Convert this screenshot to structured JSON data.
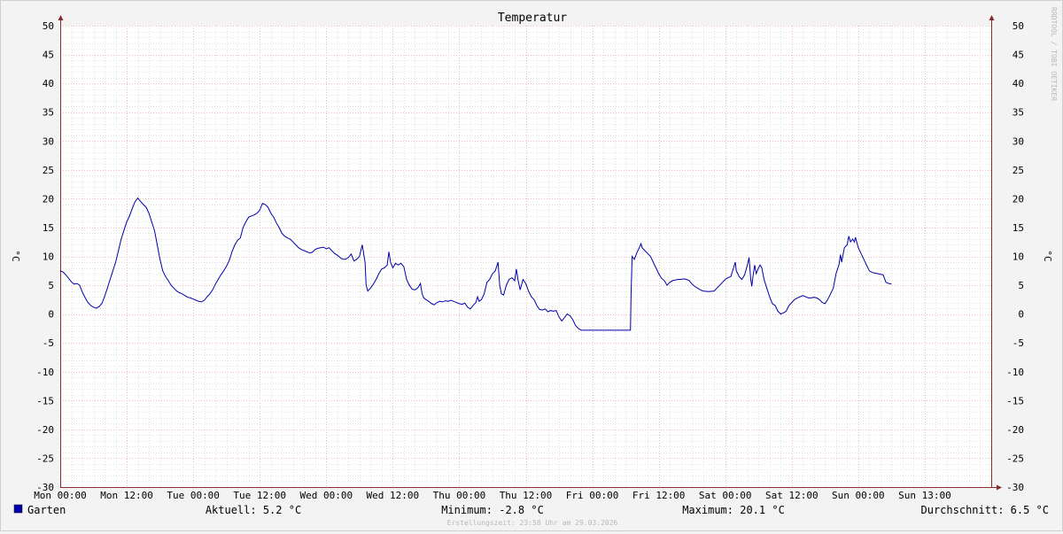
{
  "chart_data": {
    "type": "line",
    "title": "Temperatur",
    "ylabel": "°C",
    "ylabel_right": "°C",
    "ylim": [
      -30,
      50
    ],
    "ytick_step": 5,
    "xlim_hours": [
      0,
      168
    ],
    "x_ticks": [
      {
        "hour": 0,
        "label": "Mon 00:00"
      },
      {
        "hour": 12,
        "label": "Mon 12:00"
      },
      {
        "hour": 24,
        "label": "Tue 00:00"
      },
      {
        "hour": 36,
        "label": "Tue 12:00"
      },
      {
        "hour": 48,
        "label": "Wed 00:00"
      },
      {
        "hour": 60,
        "label": "Wed 12:00"
      },
      {
        "hour": 72,
        "label": "Thu 00:00"
      },
      {
        "hour": 84,
        "label": "Thu 12:00"
      },
      {
        "hour": 96,
        "label": "Fri 00:00"
      },
      {
        "hour": 108,
        "label": "Fri 12:00"
      },
      {
        "hour": 120,
        "label": "Sat 00:00"
      },
      {
        "hour": 132,
        "label": "Sat 12:00"
      },
      {
        "hour": 144,
        "label": "Sun 00:00"
      },
      {
        "hour": 156,
        "label": "Sun 13:00"
      }
    ],
    "grid": true,
    "series": [
      {
        "name": "Garten",
        "color": "#0000aa",
        "points": [
          [
            0,
            7.5
          ],
          [
            0.5,
            7.3
          ],
          [
            1,
            6.8
          ],
          [
            1.5,
            6.2
          ],
          [
            2,
            5.6
          ],
          [
            2.5,
            5.2
          ],
          [
            3,
            5.3
          ],
          [
            3.5,
            5.0
          ],
          [
            4,
            3.8
          ],
          [
            4.5,
            2.8
          ],
          [
            5,
            2.0
          ],
          [
            5.5,
            1.5
          ],
          [
            6,
            1.2
          ],
          [
            6.5,
            1.0
          ],
          [
            7,
            1.3
          ],
          [
            7.5,
            1.8
          ],
          [
            8,
            3.0
          ],
          [
            8.5,
            4.5
          ],
          [
            9,
            6.0
          ],
          [
            9.5,
            7.5
          ],
          [
            10,
            9.0
          ],
          [
            10.5,
            11.0
          ],
          [
            11,
            13.0
          ],
          [
            11.5,
            14.5
          ],
          [
            12,
            16.0
          ],
          [
            12.5,
            17.0
          ],
          [
            13,
            18.3
          ],
          [
            13.5,
            19.5
          ],
          [
            14,
            20.1
          ],
          [
            14.5,
            19.5
          ],
          [
            15,
            19.0
          ],
          [
            15.5,
            18.5
          ],
          [
            16,
            17.5
          ],
          [
            16.5,
            16.0
          ],
          [
            17,
            14.5
          ],
          [
            17.5,
            12.0
          ],
          [
            18,
            9.5
          ],
          [
            18.5,
            7.5
          ],
          [
            19,
            6.5
          ],
          [
            19.5,
            5.8
          ],
          [
            20,
            5.0
          ],
          [
            20.5,
            4.5
          ],
          [
            21,
            4.0
          ],
          [
            21.5,
            3.7
          ],
          [
            22,
            3.5
          ],
          [
            22.5,
            3.2
          ],
          [
            23,
            2.9
          ],
          [
            23.5,
            2.8
          ],
          [
            24,
            2.6
          ],
          [
            24.5,
            2.4
          ],
          [
            25,
            2.2
          ],
          [
            25.5,
            2.1
          ],
          [
            26,
            2.4
          ],
          [
            26.5,
            3.0
          ],
          [
            27,
            3.5
          ],
          [
            27.5,
            4.2
          ],
          [
            28,
            5.2
          ],
          [
            28.5,
            6.0
          ],
          [
            29,
            6.8
          ],
          [
            29.5,
            7.5
          ],
          [
            30,
            8.3
          ],
          [
            30.5,
            9.3
          ],
          [
            31,
            10.8
          ],
          [
            31.5,
            12.0
          ],
          [
            32,
            12.8
          ],
          [
            32.5,
            13.2
          ],
          [
            33,
            15.0
          ],
          [
            33.5,
            16.0
          ],
          [
            34,
            16.8
          ],
          [
            34.5,
            17.0
          ],
          [
            35,
            17.2
          ],
          [
            35.5,
            17.5
          ],
          [
            36,
            18.0
          ],
          [
            36.5,
            19.2
          ],
          [
            37,
            19.0
          ],
          [
            37.5,
            18.5
          ],
          [
            38,
            17.5
          ],
          [
            38.5,
            16.8
          ],
          [
            39,
            15.8
          ],
          [
            39.5,
            15.0
          ],
          [
            40,
            14.0
          ],
          [
            40.5,
            13.5
          ],
          [
            41,
            13.2
          ],
          [
            41.5,
            13.0
          ],
          [
            42,
            12.5
          ],
          [
            42.5,
            12.0
          ],
          [
            43,
            11.5
          ],
          [
            43.5,
            11.2
          ],
          [
            44,
            11.0
          ],
          [
            44.5,
            10.8
          ],
          [
            45,
            10.6
          ],
          [
            45.5,
            10.7
          ],
          [
            46,
            11.2
          ],
          [
            46.5,
            11.4
          ],
          [
            47,
            11.5
          ],
          [
            47.5,
            11.6
          ],
          [
            48,
            11.3
          ],
          [
            48.5,
            11.5
          ],
          [
            49,
            11.0
          ],
          [
            49.5,
            10.5
          ],
          [
            50,
            10.2
          ],
          [
            50.5,
            9.8
          ],
          [
            51,
            9.5
          ],
          [
            51.5,
            9.5
          ],
          [
            52,
            9.8
          ],
          [
            52.5,
            10.4
          ],
          [
            53,
            9.2
          ],
          [
            53.5,
            9.5
          ],
          [
            54,
            10.0
          ],
          [
            54.5,
            12.0
          ],
          [
            55,
            9.0
          ],
          [
            55.2,
            5.0
          ],
          [
            55.5,
            4.0
          ],
          [
            56,
            4.5
          ],
          [
            56.5,
            5.2
          ],
          [
            57,
            6.0
          ],
          [
            57.5,
            7.0
          ],
          [
            58,
            7.8
          ],
          [
            58.5,
            8.0
          ],
          [
            59,
            8.5
          ],
          [
            59.3,
            10.8
          ],
          [
            59.6,
            9.0
          ],
          [
            60,
            8.0
          ],
          [
            60.5,
            8.8
          ],
          [
            61,
            8.5
          ],
          [
            61.5,
            8.8
          ],
          [
            62,
            8.2
          ],
          [
            62.5,
            6.0
          ],
          [
            63,
            5.0
          ],
          [
            63.5,
            4.3
          ],
          [
            64,
            4.2
          ],
          [
            64.5,
            4.5
          ],
          [
            65,
            5.3
          ],
          [
            65.3,
            3.5
          ],
          [
            65.6,
            2.8
          ],
          [
            66,
            2.5
          ],
          [
            66.5,
            2.2
          ],
          [
            67,
            1.8
          ],
          [
            67.5,
            1.6
          ],
          [
            68,
            2.0
          ],
          [
            68.5,
            2.2
          ],
          [
            69,
            2.1
          ],
          [
            69.5,
            2.3
          ],
          [
            70,
            2.2
          ],
          [
            70.5,
            2.4
          ],
          [
            71,
            2.2
          ],
          [
            71.5,
            2.0
          ],
          [
            72,
            1.8
          ],
          [
            72.5,
            1.7
          ],
          [
            73,
            1.9
          ],
          [
            73.5,
            1.2
          ],
          [
            74,
            0.9
          ],
          [
            74.5,
            1.5
          ],
          [
            75,
            2.0
          ],
          [
            75.3,
            3.0
          ],
          [
            75.6,
            2.2
          ],
          [
            76,
            2.5
          ],
          [
            76.5,
            3.5
          ],
          [
            77,
            5.5
          ],
          [
            77.5,
            6.0
          ],
          [
            78,
            7.0
          ],
          [
            78.5,
            7.5
          ],
          [
            79,
            9.0
          ],
          [
            79.3,
            5.0
          ],
          [
            79.6,
            3.5
          ],
          [
            80,
            3.3
          ],
          [
            80.5,
            5.0
          ],
          [
            81,
            6.0
          ],
          [
            81.5,
            6.3
          ],
          [
            82,
            5.8
          ],
          [
            82.3,
            7.8
          ],
          [
            82.6,
            6.0
          ],
          [
            83,
            4.2
          ],
          [
            83.5,
            6.0
          ],
          [
            84,
            5.3
          ],
          [
            84.5,
            4.0
          ],
          [
            85,
            3.0
          ],
          [
            85.5,
            2.5
          ],
          [
            86,
            1.5
          ],
          [
            86.5,
            0.8
          ],
          [
            87,
            0.7
          ],
          [
            87.5,
            0.9
          ],
          [
            88,
            0.4
          ],
          [
            88.5,
            0.6
          ],
          [
            89,
            0.5
          ],
          [
            89.5,
            0.6
          ],
          [
            90,
            -0.5
          ],
          [
            90.5,
            -1.2
          ],
          [
            91,
            -0.6
          ],
          [
            91.5,
            0.0
          ],
          [
            92,
            -0.3
          ],
          [
            92.5,
            -1.0
          ],
          [
            93,
            -2.0
          ],
          [
            93.5,
            -2.5
          ],
          [
            94,
            -2.8
          ],
          [
            95,
            -2.8
          ],
          [
            96,
            -2.8
          ],
          [
            97,
            -2.8
          ],
          [
            98,
            -2.8
          ],
          [
            99,
            -2.8
          ],
          [
            100,
            -2.8
          ],
          [
            101,
            -2.8
          ],
          [
            102,
            -2.8
          ],
          [
            102.9,
            -2.8
          ],
          [
            103,
            3.5
          ],
          [
            103.2,
            10.0
          ],
          [
            103.6,
            9.5
          ],
          [
            104,
            10.5
          ],
          [
            104.5,
            11.5
          ],
          [
            104.8,
            12.2
          ],
          [
            105,
            11.5
          ],
          [
            105.5,
            11.0
          ],
          [
            106,
            10.5
          ],
          [
            106.5,
            10.0
          ],
          [
            107,
            9.0
          ],
          [
            107.5,
            8.0
          ],
          [
            108,
            7.0
          ],
          [
            108.5,
            6.2
          ],
          [
            109,
            5.8
          ],
          [
            109.5,
            5.0
          ],
          [
            110,
            5.5
          ],
          [
            110.5,
            5.8
          ],
          [
            111,
            5.9
          ],
          [
            111.5,
            6.0
          ],
          [
            112,
            6.0
          ],
          [
            112.5,
            6.1
          ],
          [
            113,
            6.0
          ],
          [
            113.5,
            5.8
          ],
          [
            114,
            5.2
          ],
          [
            114.5,
            4.8
          ],
          [
            115,
            4.5
          ],
          [
            115.5,
            4.2
          ],
          [
            116,
            4.0
          ],
          [
            117,
            3.9
          ],
          [
            118,
            4.0
          ],
          [
            118.5,
            4.5
          ],
          [
            119,
            5.0
          ],
          [
            119.5,
            5.5
          ],
          [
            120,
            6.0
          ],
          [
            120.5,
            6.3
          ],
          [
            121,
            6.5
          ],
          [
            121.5,
            8.0
          ],
          [
            121.8,
            9.0
          ],
          [
            122,
            7.5
          ],
          [
            122.5,
            6.5
          ],
          [
            123,
            6.0
          ],
          [
            123.5,
            6.8
          ],
          [
            124,
            8.5
          ],
          [
            124.3,
            9.8
          ],
          [
            124.6,
            6.0
          ],
          [
            124.8,
            4.8
          ],
          [
            125,
            6.5
          ],
          [
            125.3,
            8.5
          ],
          [
            125.6,
            7.0
          ],
          [
            126,
            8.0
          ],
          [
            126.3,
            8.5
          ],
          [
            126.6,
            8.0
          ],
          [
            127,
            6.0
          ],
          [
            127.5,
            4.5
          ],
          [
            128,
            3.0
          ],
          [
            128.5,
            1.8
          ],
          [
            129,
            1.5
          ],
          [
            129.5,
            0.5
          ],
          [
            130,
            0.0
          ],
          [
            130.5,
            0.2
          ],
          [
            131,
            0.5
          ],
          [
            131.5,
            1.5
          ],
          [
            132,
            2.0
          ],
          [
            132.5,
            2.5
          ],
          [
            133,
            2.8
          ],
          [
            133.5,
            3.0
          ],
          [
            134,
            3.2
          ],
          [
            134.5,
            3.0
          ],
          [
            135,
            2.8
          ],
          [
            135.5,
            2.8
          ],
          [
            136,
            2.9
          ],
          [
            136.5,
            2.8
          ],
          [
            137,
            2.5
          ],
          [
            137.5,
            2.0
          ],
          [
            138,
            1.8
          ],
          [
            138.5,
            2.5
          ],
          [
            139,
            3.5
          ],
          [
            139.5,
            4.5
          ],
          [
            140,
            7.0
          ],
          [
            140.5,
            8.5
          ],
          [
            140.8,
            10.3
          ],
          [
            141,
            9.0
          ],
          [
            141.5,
            11.5
          ],
          [
            142,
            12.0
          ],
          [
            142.3,
            13.5
          ],
          [
            142.6,
            12.5
          ],
          [
            143,
            13.0
          ],
          [
            143.3,
            12.5
          ],
          [
            143.5,
            13.3
          ],
          [
            144,
            11.5
          ],
          [
            144.5,
            10.5
          ],
          [
            145,
            9.5
          ],
          [
            145.5,
            8.5
          ],
          [
            146,
            7.5
          ],
          [
            146.5,
            7.2
          ],
          [
            147,
            7.1
          ],
          [
            147.5,
            7.0
          ],
          [
            148,
            6.9
          ],
          [
            148.5,
            6.8
          ],
          [
            149,
            5.5
          ],
          [
            149.5,
            5.3
          ],
          [
            150,
            5.2
          ]
        ]
      }
    ]
  },
  "legend": {
    "series_name": "Garten",
    "series_color": "#0000aa",
    "aktuell": "Aktuell: 5.2 °C",
    "minimum": "Minimum: -2.8 °C",
    "maximum": "Maximum: 20.1 °C",
    "durchschnitt": "Durchschnitt: 6.5 °C"
  },
  "footer": "Erstellungszeit: 23:58 Uhr am 29.03.2026",
  "watermark": "RRDTOOL / TOBI OETIKER",
  "colors": {
    "background": "#f3f3f3",
    "plot": "#ffffff",
    "grid_minor": "#e2e2e2",
    "grid_major": "#f2b7b7",
    "axis": "#8b2a2a",
    "line": "#0000aa"
  }
}
